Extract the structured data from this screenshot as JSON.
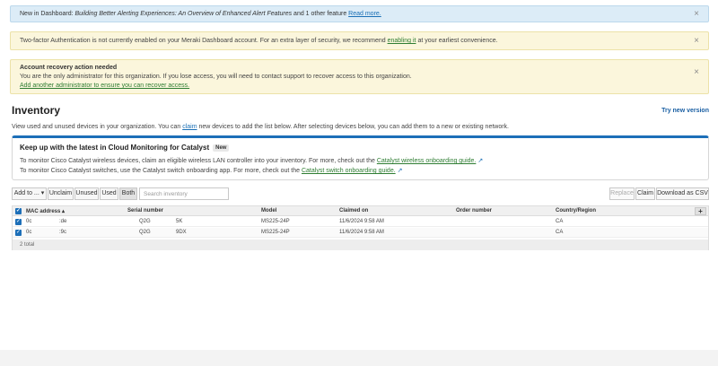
{
  "banners": {
    "info": {
      "prefix": "New in Dashboard: ",
      "headline": "Building Better Alerting Experiences: An Overview of Enhanced Alert Features",
      "suffix": " and 1 other feature",
      "link": "Read more."
    },
    "two_factor": {
      "text": "Two-factor Authentication is not currently enabled on your Meraki Dashboard account. For an extra layer of security, we recommend ",
      "link": "enabling it",
      "suffix": " at your earliest convenience."
    },
    "recovery": {
      "title": "Account recovery action needed",
      "text": "You are the only administrator for this organization. If you lose access, you will need to contact support to recover access to this organization.",
      "link": "Add another administrator to ensure you can recover access."
    },
    "close_glyph": "×"
  },
  "inventory": {
    "title": "Inventory",
    "try_new": "Try new version",
    "desc_before": "View used and unused devices in your organization. You can ",
    "desc_link": "claim",
    "desc_after": " new devices to add the list below. After selecting devices below, you can add them to a new or existing network."
  },
  "monitor_card": {
    "title": "Keep up with the latest in Cloud Monitoring for Catalyst",
    "badge": "New",
    "line1_text": "To monitor Cisco Catalyst wireless devices, claim an eligible wireless LAN controller into your inventory. For more, check out the ",
    "line1_link": "Catalyst wireless onboarding guide.",
    "line2_text": "To monitor Cisco Catalyst switches, use the Catalyst switch onboarding app. For more, check out the ",
    "line2_link": "Catalyst switch onboarding guide.",
    "ext_glyph": "↗"
  },
  "toolbar": {
    "add_to": "Add to ... ▾",
    "unclaim": "Unclaim",
    "unused": "Unused",
    "used": "Used",
    "both": "Both",
    "search_placeholder": "Search inventory",
    "replace": "Replace",
    "claim": "Claim",
    "download": "Download as CSV"
  },
  "table": {
    "columns": {
      "mac": "MAC address ▴",
      "serial": "Serial number",
      "model": "Model",
      "claimed": "Claimed on",
      "order": "Order number",
      "country": "Country/Region"
    },
    "rows": [
      {
        "mac_a": "0c",
        "mac_b": ":de",
        "serial_a": "Q2G",
        "serial_b": "5K",
        "model": "MS225-24P",
        "claimed": "11/6/2024 9:58 AM",
        "order": "",
        "country": "CA"
      },
      {
        "mac_a": "0c",
        "mac_b": ":9c",
        "serial_a": "Q2G",
        "serial_b": "9DX",
        "model": "MS225-24P",
        "claimed": "11/6/2024 9:58 AM",
        "order": "",
        "country": "CA"
      }
    ],
    "footer": "2 total",
    "plus": "+",
    "check": "✓"
  }
}
